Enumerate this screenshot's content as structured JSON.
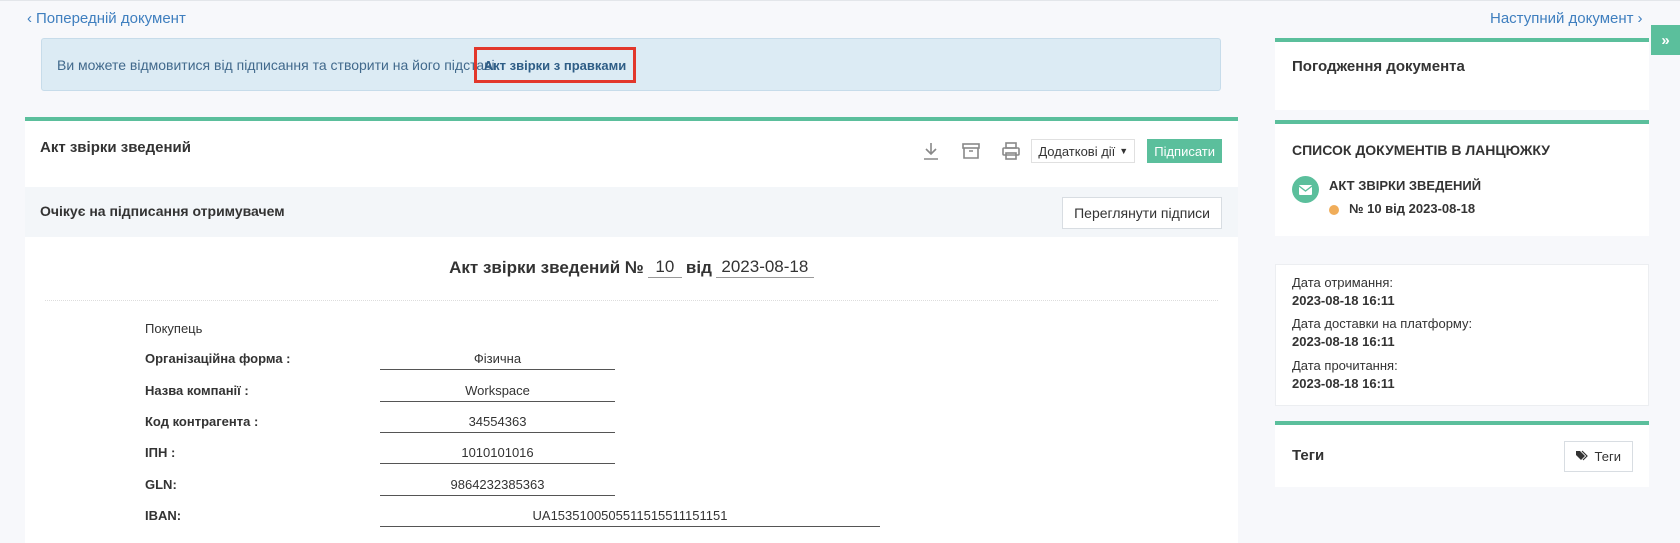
{
  "nav": {
    "prev_label": "Попередній документ",
    "next_label": "Наступний документ",
    "side_toggle": "»"
  },
  "alert": {
    "text": "Ви можете відмовитися від підписання та створити на його підставі",
    "link": "Акт звірки з правками"
  },
  "document": {
    "title": "Акт звірки зведений",
    "toolbar": {
      "icons": [
        "download-icon",
        "archive-icon",
        "print-icon"
      ],
      "more_actions": "Додаткові дії",
      "sign": "Підписати"
    },
    "status": "Очікує на підписання отримувачем",
    "view_signatures": "Переглянути підписи",
    "heading": {
      "prefix": "Акт звірки зведений №",
      "number": "10",
      "from_word": "від",
      "date": "2023-08-18"
    },
    "buyer_label": "Покупець",
    "fields": [
      {
        "label": "Організаційна форма :",
        "value": "Фізична"
      },
      {
        "label": "Назва компанії :",
        "value": "Workspace"
      },
      {
        "label": "Код контрагента :",
        "value": "34554363"
      },
      {
        "label": "ІПН :",
        "value": "1010101016"
      },
      {
        "label": "GLN:",
        "value": "9864232385363"
      },
      {
        "label": "IBAN:",
        "value": "UA1535100505511515511151151"
      }
    ]
  },
  "approval": {
    "title": "Погодження документа"
  },
  "chain": {
    "title": "СПИСОК ДОКУМЕНТІВ В ЛАНЦЮЖКУ",
    "doc_title": "АКТ ЗВІРКИ ЗВЕДЕНИЙ",
    "doc_number": "№ 10 від 2023-08-18",
    "icon": "envelope-icon",
    "status_color": "#f0ad5a"
  },
  "dates": {
    "received_label": "Дата отримання:",
    "received_value": "2023-08-18 16:11",
    "delivered_label": "Дата доставки на платформу:",
    "delivered_value": "2023-08-18 16:11",
    "read_label": "Дата прочитання:",
    "read_value": "2023-08-18 16:11"
  },
  "tags": {
    "title": "Теги",
    "button": "Теги",
    "icon": "tags-icon"
  },
  "colors": {
    "accent": "#5bbf9c",
    "link": "#3f7fbf",
    "alert_bg": "#dcebf4",
    "highlight": "#e2372b"
  }
}
